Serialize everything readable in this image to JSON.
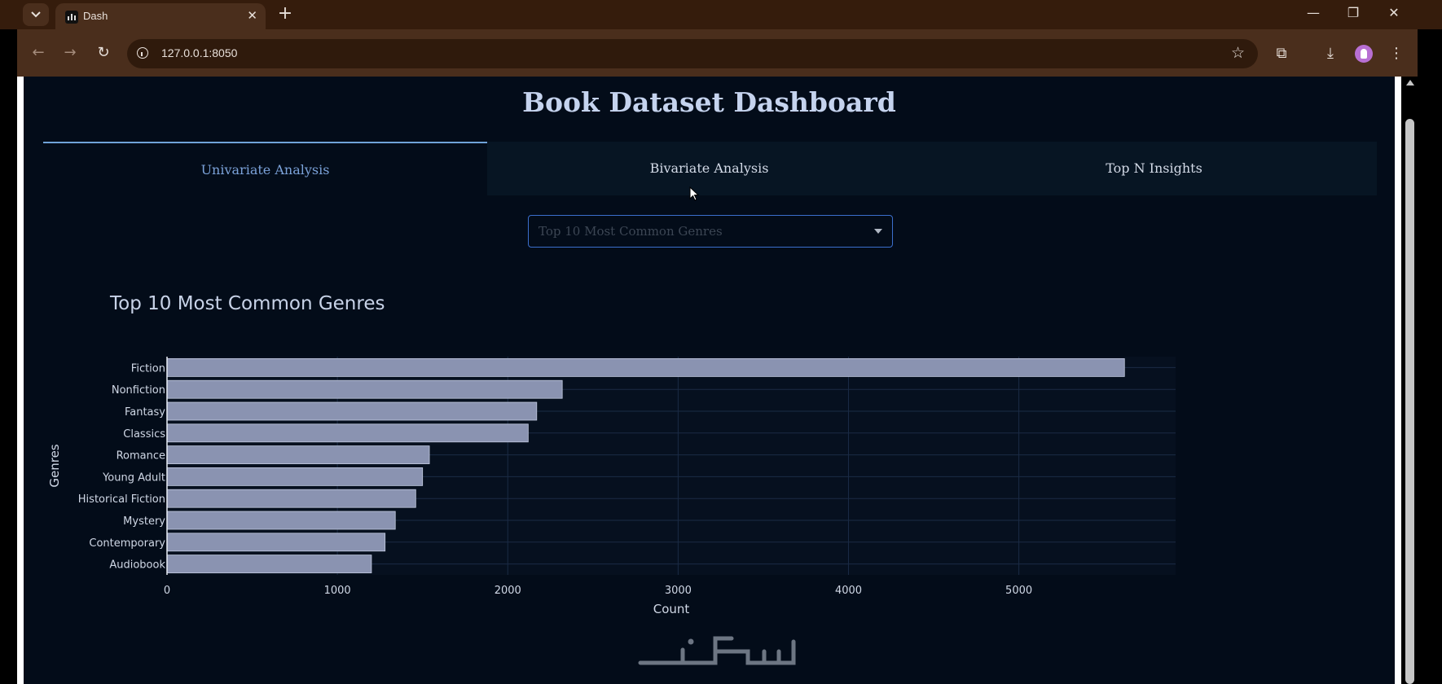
{
  "browser": {
    "tab_title": "Dash",
    "url": "127.0.0.1:8050"
  },
  "page": {
    "title": "Book Dataset Dashboard",
    "tabs": [
      {
        "label": "Univariate Analysis",
        "active": true
      },
      {
        "label": "Bivariate Analysis",
        "active": false
      },
      {
        "label": "Top N Insights",
        "active": false
      }
    ],
    "dropdown": {
      "selected": "Top 10 Most Common Genres"
    }
  },
  "chart_data": {
    "type": "bar",
    "orientation": "horizontal",
    "title": "Top 10 Most Common Genres",
    "xlabel": "Count",
    "ylabel": "Genres",
    "categories": [
      "Fiction",
      "Nonfiction",
      "Fantasy",
      "Classics",
      "Romance",
      "Young Adult",
      "Historical Fiction",
      "Mystery",
      "Contemporary",
      "Audiobook"
    ],
    "values": [
      5620,
      2320,
      2170,
      2120,
      1540,
      1500,
      1460,
      1340,
      1280,
      1200
    ],
    "xticks": [
      0,
      1000,
      2000,
      3000,
      4000,
      5000
    ],
    "xlim": [
      0,
      5920
    ],
    "grid": true,
    "colors": {
      "bar": "#8a93b1",
      "bar_edge": "#c3cbe0",
      "plot_bg": "#06101f",
      "grid": "#1b2b45",
      "text": "#d0d8e6"
    }
  },
  "watermark": "خكسات"
}
